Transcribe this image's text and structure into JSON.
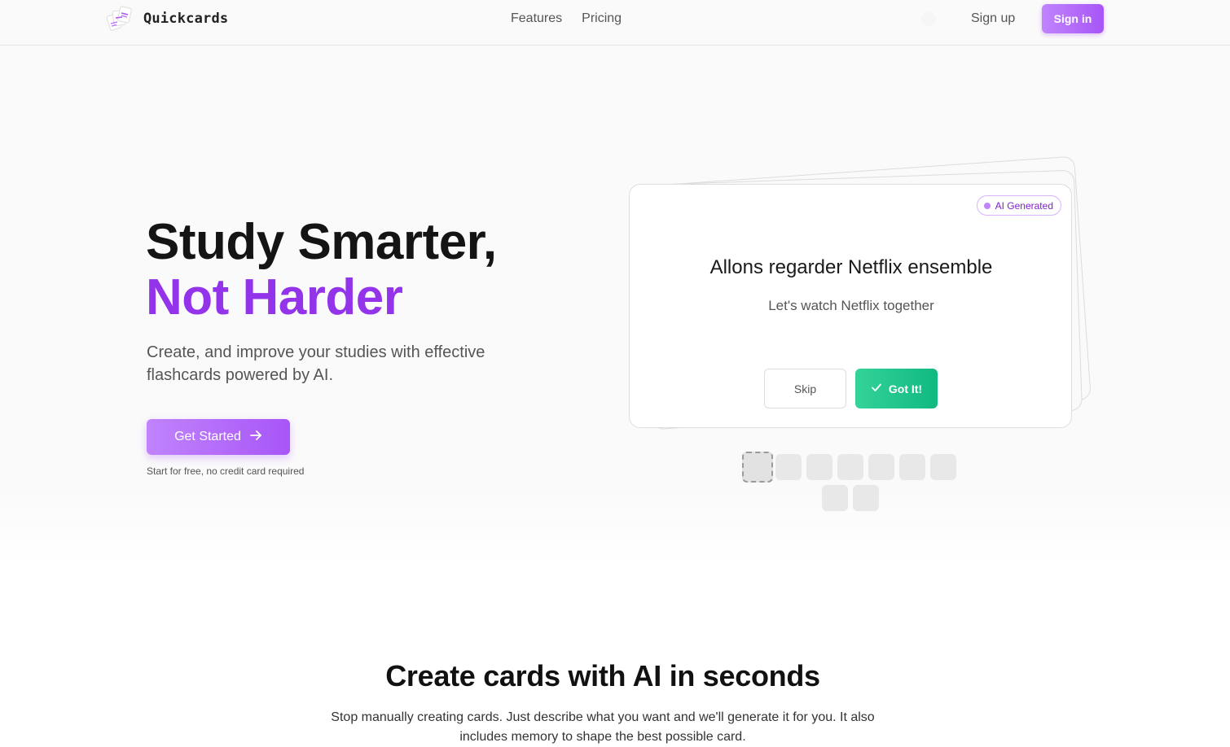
{
  "nav": {
    "brand": "Quickcards",
    "links": [
      "Features",
      "Pricing"
    ],
    "signup": "Sign up",
    "signin": "Sign in"
  },
  "hero": {
    "title_line1": "Study Smarter,",
    "title_line2": "Not Harder",
    "subtitle": "Create, and improve your studies with effective flashcards powered by AI.",
    "cta": "Get Started",
    "cta_note": "Start for free, no credit card required"
  },
  "flashcard": {
    "badge": "AI Generated",
    "front": "Allons regarder Netflix ensemble",
    "back": "Let's watch Netflix together",
    "skip": "Skip",
    "got_it": "Got It!"
  },
  "deck_progress": {
    "total_cards": 9,
    "current_index": 0
  },
  "section": {
    "title": "Create cards with AI in seconds",
    "description": "Stop manually creating cards. Just describe what you want and we'll generate it for you. It also includes memory to shape the best possible card."
  },
  "colors": {
    "accent": "#a855f7",
    "accent_text": "#9333ea",
    "success": "#10b981"
  },
  "icons": {
    "brand": "stacked-cards-icon",
    "cta": "arrow-right-icon",
    "got_it": "check-icon",
    "badge": "dot-icon"
  }
}
